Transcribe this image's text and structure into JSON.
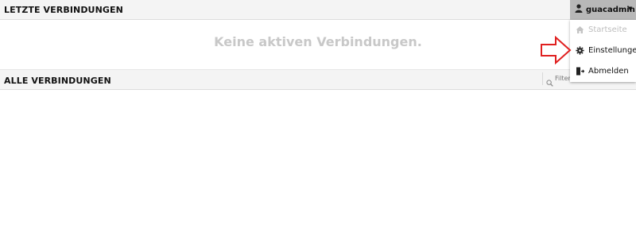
{
  "recent": {
    "title": "LETZTE VERBINDUNGEN",
    "empty_message": "Keine aktiven Verbindungen."
  },
  "all": {
    "title": "ALLE VERBINDUNGEN",
    "filter_placeholder": "Filter"
  },
  "user_menu": {
    "username": "guacadmin",
    "items": [
      {
        "label": "Startseite",
        "icon": "home-icon",
        "enabled": false
      },
      {
        "label": "Einstellungen",
        "icon": "gear-icon",
        "enabled": true
      },
      {
        "label": "Abmelden",
        "icon": "logout-icon",
        "enabled": true
      }
    ]
  },
  "colors": {
    "header_bg": "#f4f4f4",
    "user_button_bg": "#b8b8b8",
    "annotation_arrow": "#e02020",
    "empty_text": "#c8c8c8"
  }
}
